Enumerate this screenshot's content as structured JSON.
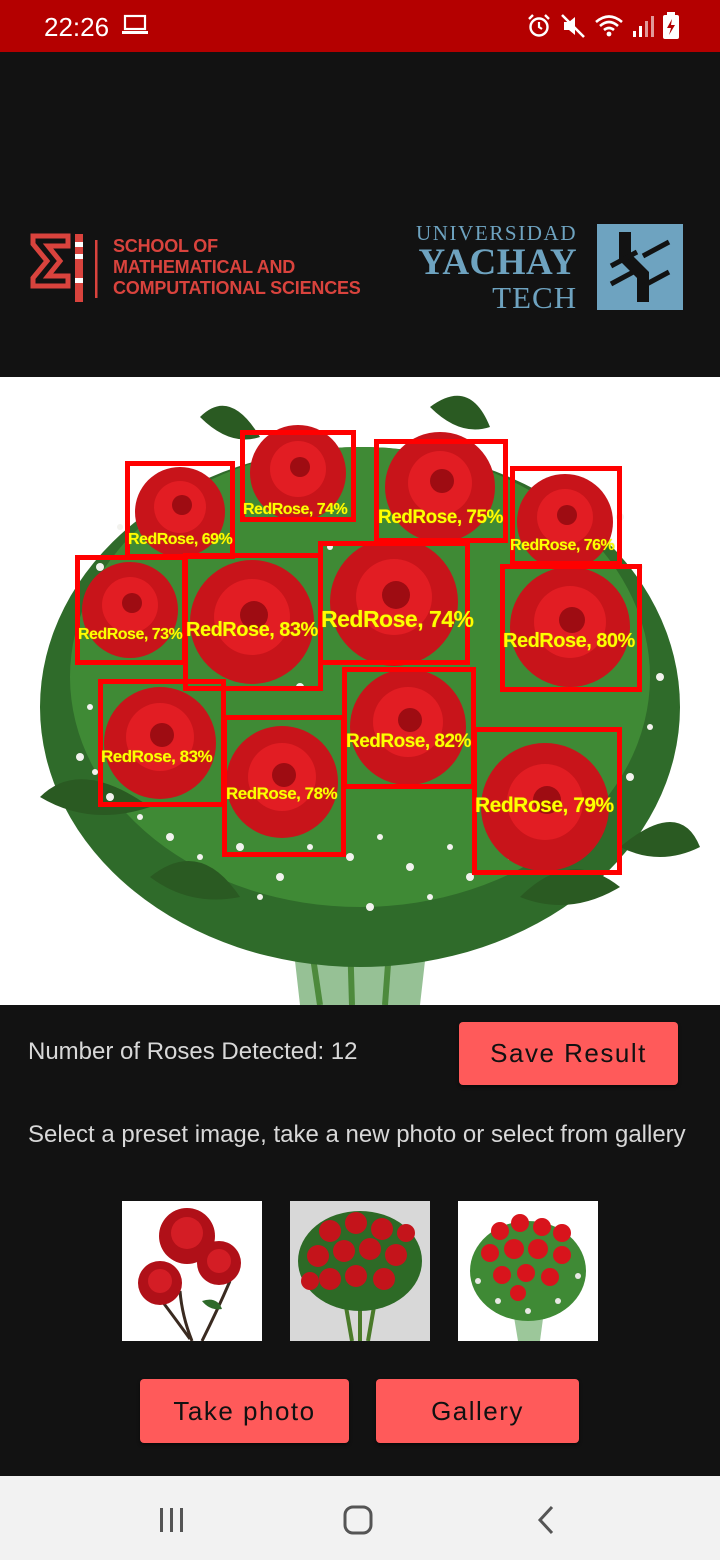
{
  "status_bar": {
    "time": "22:26",
    "icons": [
      "laptop-icon",
      "alarm-icon",
      "mute-icon",
      "wifi-icon",
      "signal-icon",
      "battery-charging-icon"
    ],
    "color": "#b40000"
  },
  "header": {
    "school_lines": [
      "SCHOOL OF",
      "MATHEMATICAL AND",
      "COMPUTATIONAL SCIENCES"
    ],
    "yachay_top": "UNIVERSIDAD",
    "yachay_mid": "YACHAY",
    "yachay_bot": "TECH",
    "school_color": "#d9433d",
    "yachay_color": "#6ea3c0"
  },
  "detections": [
    {
      "label": "RedRose, 69%"
    },
    {
      "label": "RedRose, 74%"
    },
    {
      "label": "RedRose, 75%"
    },
    {
      "label": "RedRose, 76%"
    },
    {
      "label": "RedRose, 73%"
    },
    {
      "label": "RedRose, 83%"
    },
    {
      "label": "RedRose, 74%"
    },
    {
      "label": "RedRose, 80%"
    },
    {
      "label": "RedRose, 83%"
    },
    {
      "label": "RedRose, 82%"
    },
    {
      "label": "RedRose, 78%"
    },
    {
      "label": "RedRose, 79%"
    }
  ],
  "main": {
    "count_text": "Number of Roses Detected: 12",
    "save_button": "Save Result",
    "instruction": "Select a preset image, take a new photo or select from gallery",
    "take_photo_button": "Take photo",
    "gallery_button": "Gallery",
    "accent_color": "#ff5a5a"
  },
  "nav_bar": {
    "icons": [
      "recent-apps-icon",
      "home-icon",
      "back-icon"
    ]
  }
}
